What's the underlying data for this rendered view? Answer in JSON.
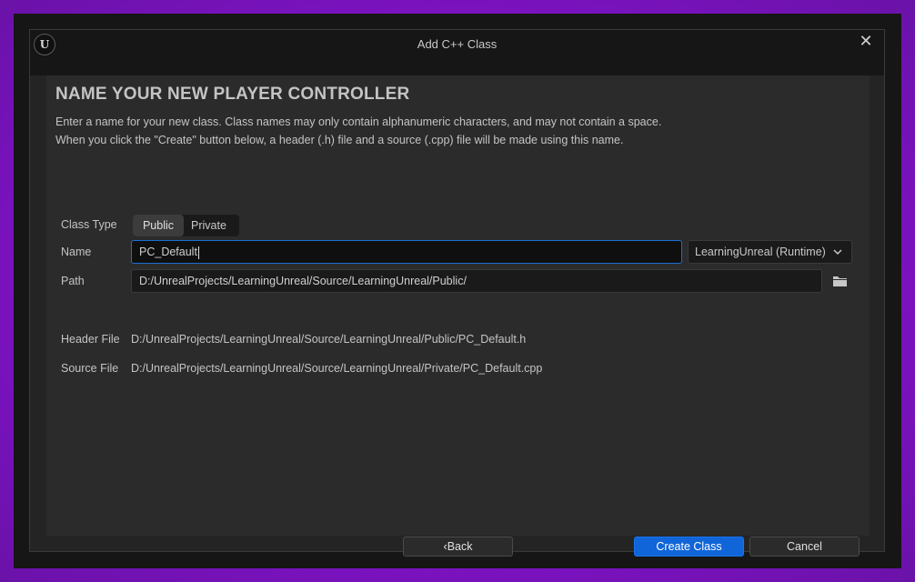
{
  "window": {
    "title": "Add C++ Class",
    "logo_text": "U",
    "close_glyph": "✕"
  },
  "page": {
    "heading": "NAME YOUR NEW PLAYER CONTROLLER",
    "description_line1": "Enter a name for your new class. Class names may only contain alphanumeric characters, and may not contain a space.",
    "description_line2": "When you click the \"Create\" button below, a header (.h) file and a source (.cpp) file will be made using this name."
  },
  "form": {
    "class_type_label": "Class Type",
    "class_type_options": [
      "Public",
      "Private"
    ],
    "class_type_selected": "Public",
    "name_label": "Name",
    "name_value": "PC_Default",
    "module_value": "LearningUnreal (Runtime)",
    "path_label": "Path",
    "path_value": "D:/UnrealProjects/LearningUnreal/Source/LearningUnreal/Public/",
    "header_file_label": "Header File",
    "header_file_value": "D:/UnrealProjects/LearningUnreal/Source/LearningUnreal/Public/PC_Default.h",
    "source_file_label": "Source File",
    "source_file_value": "D:/UnrealProjects/LearningUnreal/Source/LearningUnreal/Private/PC_Default.cpp"
  },
  "buttons": {
    "back": "Back",
    "back_glyph": "‹",
    "create": "Create Class",
    "cancel": "Cancel"
  },
  "icons": {
    "logo": "unreal-logo-icon",
    "close": "close-icon",
    "folder": "folder-icon",
    "chevron": "chevron-down-icon"
  },
  "colors": {
    "accent": "#1065d8",
    "background_frame": "#7e12c4",
    "panel": "#2b2b2b"
  }
}
